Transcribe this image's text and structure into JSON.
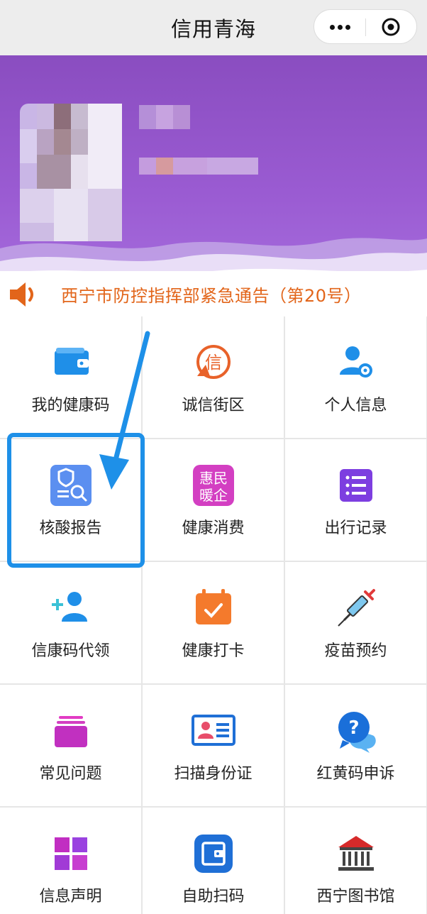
{
  "app": {
    "title": "信用青海"
  },
  "capsule": {
    "more_icon": "more-dots-icon",
    "close_icon": "close-circle-icon"
  },
  "notice": {
    "icon": "speaker-icon",
    "text": "西宁市防控指挥部紧急通告（第20号）",
    "color": "#e2651a"
  },
  "colors": {
    "header_purple": "#8a4dc0",
    "highlight_blue": "#1e90e8"
  },
  "grid": {
    "items": [
      {
        "label": "我的健康码",
        "icon": "wallet-icon"
      },
      {
        "label": "诚信街区",
        "icon": "credit-badge-icon"
      },
      {
        "label": "个人信息",
        "icon": "user-settings-icon"
      },
      {
        "label": "核酸报告",
        "icon": "shield-report-icon",
        "highlighted": true
      },
      {
        "label": "健康消费",
        "icon": "benefit-icon",
        "icon_text": [
          "惠民",
          "暖企"
        ]
      },
      {
        "label": "出行记录",
        "icon": "list-icon"
      },
      {
        "label": "信康码代领",
        "icon": "add-user-icon"
      },
      {
        "label": "健康打卡",
        "icon": "calendar-check-icon"
      },
      {
        "label": "疫苗预约",
        "icon": "syringe-icon"
      },
      {
        "label": "常见问题",
        "icon": "stack-icon"
      },
      {
        "label": "扫描身份证",
        "icon": "id-card-icon"
      },
      {
        "label": "红黄码申诉",
        "icon": "question-bubble-icon"
      },
      {
        "label": "信息声明",
        "icon": "grid-squares-icon"
      },
      {
        "label": "自助扫码",
        "icon": "wallet-scan-icon"
      },
      {
        "label": "西宁图书馆",
        "icon": "library-icon"
      }
    ]
  }
}
